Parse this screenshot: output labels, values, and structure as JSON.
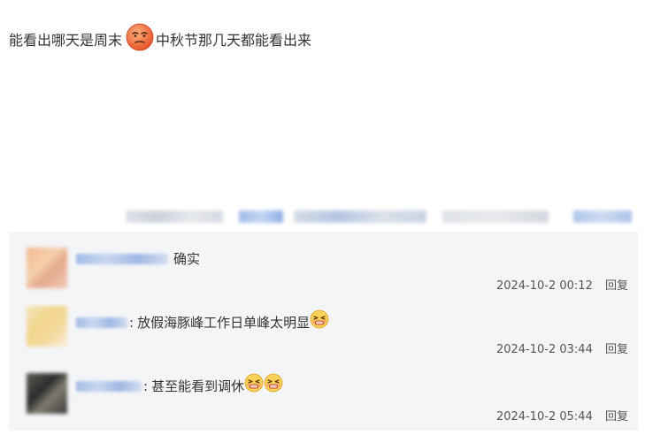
{
  "post": {
    "text_before": "能看出哪天是周末",
    "text_after": "中秋节那几天都能看出来",
    "emoji_icon": "smirk-face-icon"
  },
  "comments": [
    {
      "text": "确实",
      "emoji_count": 0,
      "timestamp": "2024-10-2 00:12",
      "reply_label": "回复"
    },
    {
      "colon": ":",
      "text": "放假海豚峰工作日单峰太明显",
      "emoji_count": 1,
      "timestamp": "2024-10-2 03:44",
      "reply_label": "回复"
    },
    {
      "colon": ":",
      "text": "甚至能看到调休",
      "emoji_count": 2,
      "timestamp": "2024-10-2 05:44",
      "reply_label": "回复"
    }
  ],
  "icons": {
    "comment_emoji": "grimace-face-icon"
  },
  "colors": {
    "comment_bg": "#f4f5f7",
    "username_blur": "#a3bde8",
    "text": "#333333",
    "meta_text": "#555555"
  }
}
